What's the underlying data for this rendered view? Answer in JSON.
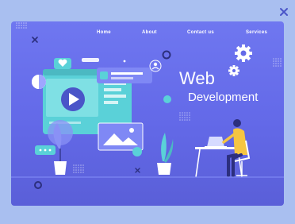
{
  "nav": {
    "items": [
      {
        "label": "Home"
      },
      {
        "label": "About"
      },
      {
        "label": "Contact us"
      },
      {
        "label": "Services"
      }
    ]
  },
  "hero": {
    "title_line1": "Web",
    "title_line2": "Development"
  },
  "icons": {
    "outer_close": "close-icon",
    "play": "play-icon",
    "gear": "gear-icon",
    "heart": "heart-icon",
    "image": "image-icon",
    "user": "user-icon"
  },
  "colors": {
    "page_bg": "#a9bff0",
    "card_bg": "#6369e8",
    "accent_teal": "#5ad1d8",
    "text": "#ffffff",
    "person_shirt": "#f5c542",
    "dark_navy": "#2c2f7e"
  }
}
